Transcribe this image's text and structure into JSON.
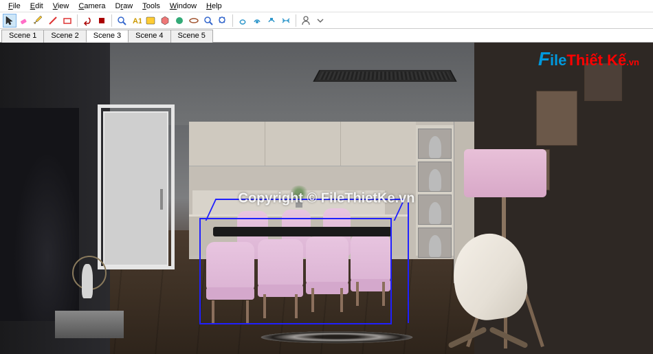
{
  "menu": {
    "file": "File",
    "edit": "Edit",
    "view": "View",
    "camera": "Camera",
    "draw": "Draw",
    "tools": "Tools",
    "window": "Window",
    "help": "Help"
  },
  "scenes": {
    "tabs": [
      "Scene 1",
      "Scene 2",
      "Scene 3",
      "Scene 4",
      "Scene 5"
    ],
    "active_index": 2
  },
  "toolbar": {
    "icons": [
      "select",
      "eraser",
      "pencil",
      "line",
      "rectangle",
      "circle",
      "arc",
      "pushpull",
      "move",
      "rotate",
      "scale",
      "offset",
      "tape",
      "dimension",
      "text",
      "paint",
      "orbit",
      "pan",
      "zoom",
      "zoom-extents",
      "section",
      "layers-1",
      "layers-2",
      "layers-3",
      "outliner",
      "user"
    ]
  },
  "watermark": {
    "logo_prefix": "File",
    "logo_mid": "Thiết Kế",
    "logo_suffix": ".vn",
    "center_text": "Copyright © FileThietKe.vn"
  },
  "colors": {
    "selection": "#2020ff",
    "chair": "#e0bad6",
    "lampshade": "#e2bcd6",
    "wood_floor": "#3f3228"
  }
}
